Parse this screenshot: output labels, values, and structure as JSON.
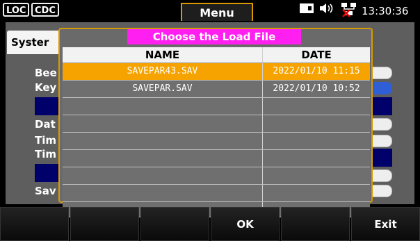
{
  "header": {
    "badges": [
      "LOC",
      "CDC"
    ],
    "menu_tab": "Menu",
    "time": "13:30:36",
    "icons": [
      "storage-icon",
      "speaker-icon",
      "network-disconnected-icon"
    ]
  },
  "background": {
    "tab": "Syster",
    "labels": [
      "Bee",
      "Key",
      "Dat",
      "Tim",
      "Tim",
      "Sav"
    ]
  },
  "dialog": {
    "title": "Choose the Load File",
    "columns": [
      "NAME",
      "DATE"
    ],
    "rows": [
      {
        "name": "SAVEPAR43.SAV",
        "date": "2022/01/10 11:15",
        "selected": true
      },
      {
        "name": "SAVEPAR.SAV",
        "date": "2022/01/10 10:52",
        "selected": false
      }
    ],
    "empty_rows": 7
  },
  "softkeys": [
    "",
    "",
    "",
    "OK",
    "",
    "Exit"
  ],
  "colors": {
    "accent": "#d99a00",
    "selected_row": "#f6a300",
    "title_bg": "#ff1ff0",
    "navy": "#00006a"
  }
}
